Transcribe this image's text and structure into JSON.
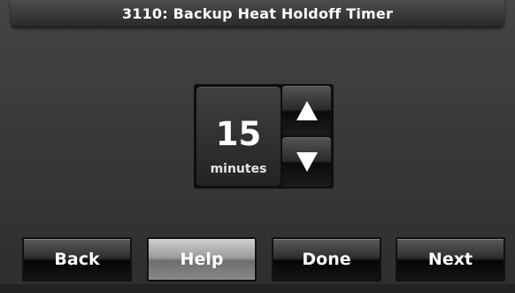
{
  "header": {
    "title": "3110: Backup Heat Holdoff Timer"
  },
  "stepper": {
    "value": "15",
    "unit": "minutes",
    "up_icon": "triangle-up",
    "down_icon": "triangle-down"
  },
  "nav": {
    "back_label": "Back",
    "help_label": "Help",
    "done_label": "Done",
    "next_label": "Next"
  },
  "colors": {
    "background": "#3a3a3a",
    "text": "#ffffff",
    "help_button": "#9a9a9a"
  }
}
